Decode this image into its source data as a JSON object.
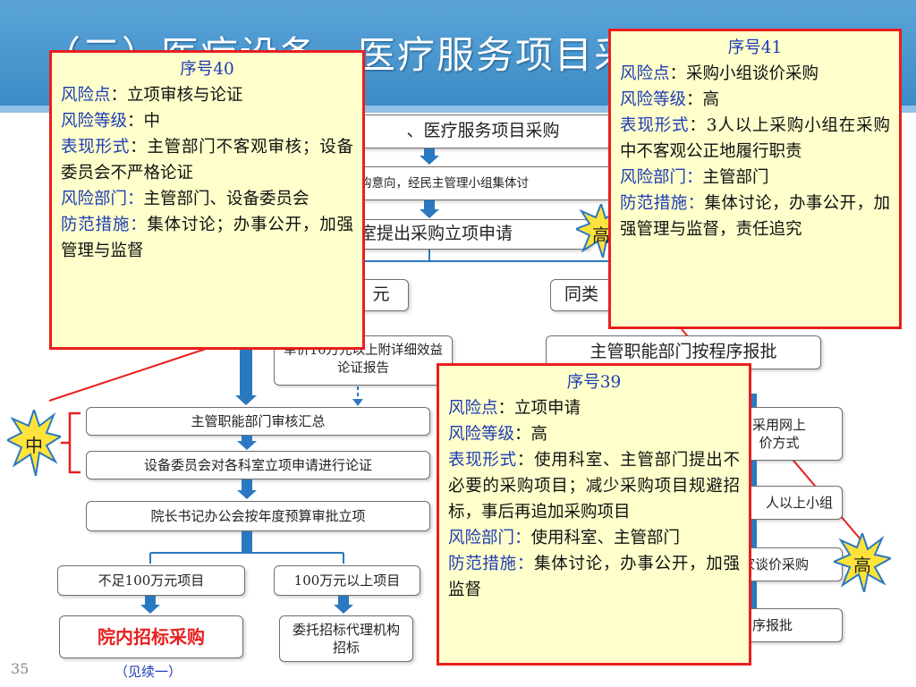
{
  "title": "（三）医疗设备、医疗服务项目采购",
  "flow": {
    "heading": "、医疗服务项目采购",
    "intent": "购意向，经民主管理小组集体讨",
    "apply": "室提出采购立项申请",
    "yuan_tail": "元",
    "same_class": "同类",
    "attach": "单价10万元以上附详细效益论证报告",
    "dept_report": "主管职能部门按程序报批",
    "review_summary": "主管职能部门审核汇总",
    "committee": "设备委员会对各科室立项申请进行论证",
    "approval": "院长书记办公会按年度预算审批立项",
    "under100": "不足100万元项目",
    "over100": "100万元以上项目",
    "inhouse": "院内招标采购",
    "agency": "委托招标代理机构招标",
    "online": "采用网上",
    "online2": "价方式",
    "group": "人以上小组",
    "negotiation": "家谈价采购",
    "report2": "序报批",
    "see_more": "（见续一）",
    "page": "35"
  },
  "levels": {
    "mid": "中",
    "high": "高",
    "right_high": "高"
  },
  "notes": {
    "n40": {
      "serial": "序号40",
      "risk_label": "风险点",
      "risk": "：立项审核与论证",
      "level_label": "风险等级",
      "level": "：中",
      "form_label": "表现形式",
      "form": "：主管部门不客观审核；设备委员会不严格论证",
      "dept_label": "风险部门：",
      "dept": "主管部门、设备委员会",
      "measure_label": "防范措施：",
      "measure": "集体讨论；办事公开，加强管理与监督"
    },
    "n41": {
      "serial": "序号41",
      "risk_label": "风险点",
      "risk": "：采购小组谈价采购",
      "level_label": "风险等级",
      "level": "：高",
      "form_label": "表现形式",
      "form": "：3人以上采购小组在采购中不客观公正地履行职责",
      "dept_label": "风险部门：",
      "dept": "主管部门",
      "measure_label": "防范措施：",
      "measure": "集体讨论，办事公开，加强管理与监督，责任追究"
    },
    "n39": {
      "serial": "序号39",
      "risk_label": "风险点",
      "risk": "：立项申请",
      "level_label": "风险等级",
      "level": "：高",
      "form_label": "表现形式",
      "form": "：使用科室、主管部门提出不必要的采购项目；减少采购项目规避招标，事后再追加采购项目",
      "dept_label": "风险部门：",
      "dept": "使用科室、主管部门",
      "measure_label": "防范措施：",
      "measure": "集体讨论，办事公开，加强监督"
    }
  },
  "colors": {
    "accent_blue": "#2a78c0",
    "note_border": "#e81f1f",
    "note_fill": "#ffffcc",
    "star_fill": "#ffe33a",
    "label_blue": "#1e3cb4",
    "highlight_red": "#e81f1f"
  }
}
